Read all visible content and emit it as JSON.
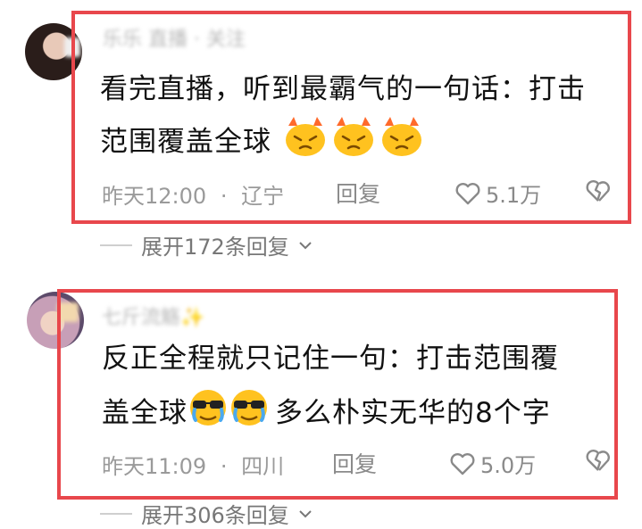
{
  "comments": [
    {
      "username": "乐乐 直播 · 关注",
      "text_line1": "看完直播，听到最霸气的一句话：打击",
      "text_line2": "范围覆盖全球",
      "time": "昨天12:00",
      "location": "辽宁",
      "reply_label": "回复",
      "likes": "5.1万",
      "expand_label": "展开172条回复",
      "emoji": [
        "angry-fire-face",
        "angry-fire-face",
        "angry-fire-face"
      ]
    },
    {
      "username": "七斤流觞✨",
      "text_line1": "反正全程就只记住一句：打击范围覆",
      "text_line2_pre": "盖全球",
      "text_line2_post": "多么朴实无华的8个字",
      "time": "昨天11:09",
      "location": "四川",
      "reply_label": "回复",
      "likes": "5.0万",
      "expand_label": "展开306条回复",
      "emoji": [
        "sunglasses-tears-face",
        "sunglasses-tears-face"
      ]
    }
  ],
  "colors": {
    "highlight_frame": "#e8474c",
    "meta_text": "#9a9a9a",
    "body_text": "#111111"
  },
  "separator": "·"
}
